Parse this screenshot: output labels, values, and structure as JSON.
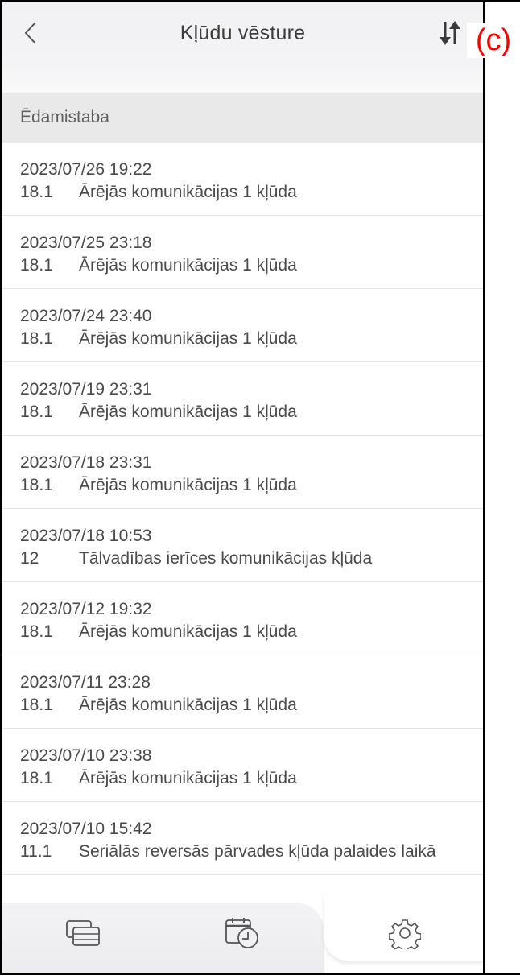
{
  "header": {
    "title": "Kļūdu vēsture",
    "back_icon": "chevron-left-icon",
    "sort_icon": "sort-arrows-icon",
    "corner_label": "(c)"
  },
  "section": {
    "title": "Ēdamistaba"
  },
  "errors": [
    {
      "date": "2023/07/26 19:22",
      "code": "18.1",
      "message": "Ārējās komunikācijas 1 kļūda"
    },
    {
      "date": "2023/07/25 23:18",
      "code": "18.1",
      "message": "Ārējās komunikācijas 1 kļūda"
    },
    {
      "date": "2023/07/24 23:40",
      "code": "18.1",
      "message": "Ārējās komunikācijas 1 kļūda"
    },
    {
      "date": "2023/07/19 23:31",
      "code": "18.1",
      "message": "Ārējās komunikācijas 1 kļūda"
    },
    {
      "date": "2023/07/18 23:31",
      "code": "18.1",
      "message": "Ārējās komunikācijas 1 kļūda"
    },
    {
      "date": "2023/07/18 10:53",
      "code": "12",
      "message": "Tālvadības ierīces komunikācijas kļūda"
    },
    {
      "date": "2023/07/12 19:32",
      "code": "18.1",
      "message": "Ārējās komunikācijas 1 kļūda"
    },
    {
      "date": "2023/07/11 23:28",
      "code": "18.1",
      "message": "Ārējās komunikācijas 1 kļūda"
    },
    {
      "date": "2023/07/10 23:38",
      "code": "18.1",
      "message": "Ārējās komunikācijas 1 kļūda"
    },
    {
      "date": "2023/07/10 15:42",
      "code": "11.1",
      "message": "Seriālās reversās pārvades kļūda palaides laikā"
    }
  ],
  "bottom_nav": [
    {
      "icon": "devices-icon",
      "active": false
    },
    {
      "icon": "calendar-clock-icon",
      "active": false
    },
    {
      "icon": "gear-icon",
      "active": true
    }
  ],
  "colors": {
    "text": "#4a4a4a",
    "section_bg": "#e9e9ea",
    "header_bg": "#f1f1f3",
    "corner_label": "#ff0000"
  }
}
